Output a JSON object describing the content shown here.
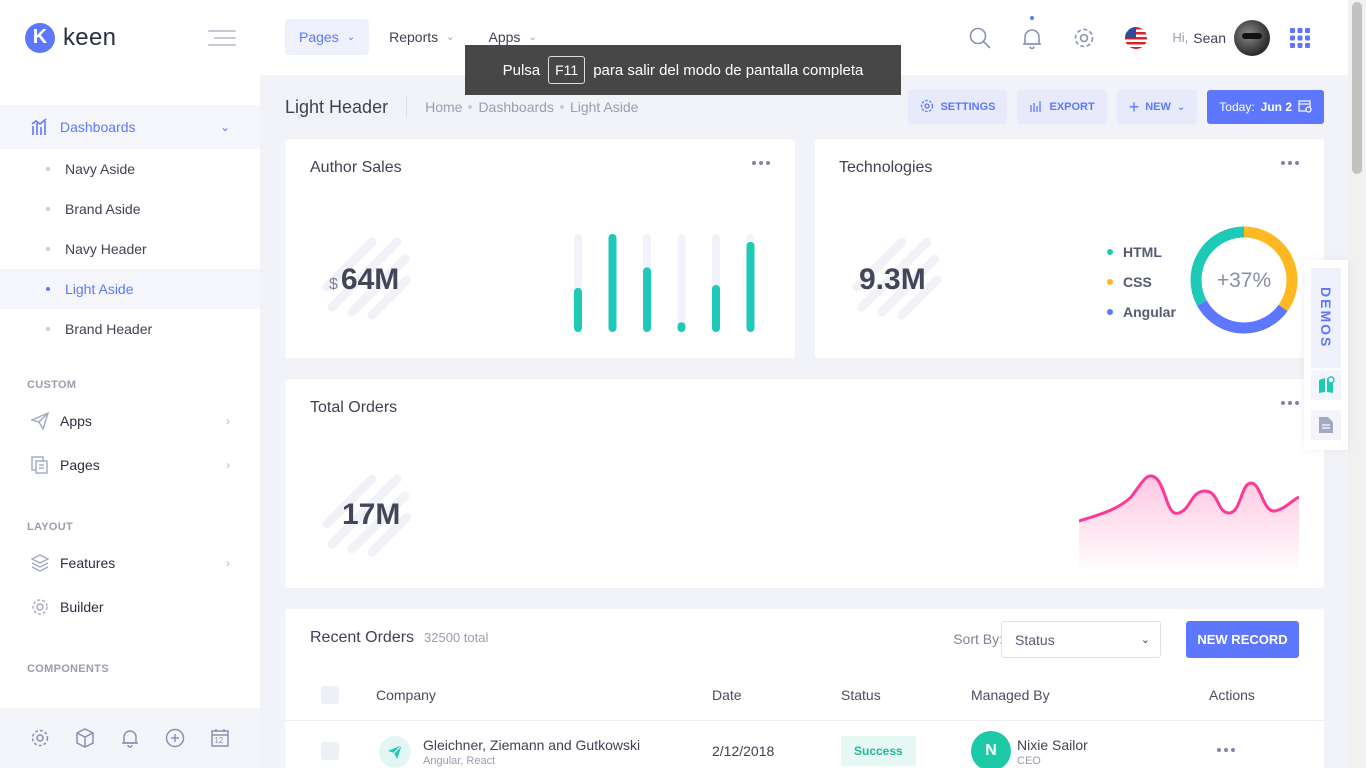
{
  "brand": {
    "name": "keen",
    "logo_letter": "K"
  },
  "sidebar": {
    "dashboards": "Dashboards",
    "dashboard_items": [
      "Navy Aside",
      "Brand Aside",
      "Navy Header",
      "Light Aside",
      "Brand Header"
    ],
    "sections": {
      "custom": "CUSTOM",
      "layout": "LAYOUT",
      "components": "COMPONENTS"
    },
    "custom_items": [
      "Apps",
      "Pages"
    ],
    "layout_items": [
      "Features",
      "Builder"
    ],
    "footer_icons": [
      "gear-icon",
      "box-icon",
      "bell-icon",
      "plus-circle-icon",
      "calendar-icon"
    ],
    "calendar_day": "12"
  },
  "header": {
    "menu": [
      "Pages",
      "Reports",
      "Apps"
    ],
    "greeting": "Hi,",
    "user": "Sean"
  },
  "toast": {
    "before": "Pulsa",
    "key": "F11",
    "after": "para salir del modo de pantalla completa"
  },
  "subheader": {
    "title": "Light Header",
    "breadcrumbs": [
      "Home",
      "Dashboards",
      "Light Aside"
    ],
    "settings": "SETTINGS",
    "export": "EXPORT",
    "new": "NEW",
    "today_label": "Today:",
    "today_value": "Jun 2"
  },
  "cards": {
    "author_sales": {
      "title": "Author Sales",
      "currency": "$",
      "value": "64M",
      "bars": [
        0.45,
        1.0,
        0.66,
        0.1,
        0.48,
        0.92
      ]
    },
    "technologies": {
      "title": "Technologies",
      "value": "9.3M",
      "legend": [
        {
          "label": "HTML",
          "color": "#1dc9b7"
        },
        {
          "label": "CSS",
          "color": "#ffb822"
        },
        {
          "label": "Angular",
          "color": "#5d78ff"
        }
      ],
      "donut_label": "+37%"
    },
    "total_orders": {
      "title": "Total Orders",
      "value": "17M"
    }
  },
  "orders": {
    "title": "Recent Orders",
    "total": "32500 total",
    "sort_label": "Sort By:",
    "status_select": "Status",
    "new_record": "NEW RECORD",
    "columns": [
      "Company",
      "Date",
      "Status",
      "Managed By",
      "Actions"
    ],
    "rows": [
      {
        "company": "Gleichner, Ziemann and Gutkowski",
        "tags": "Angular, React",
        "date": "2/12/2018",
        "status": "Success",
        "manager_initial": "N",
        "manager": "Nixie Sailor",
        "manager_role": "CEO"
      }
    ]
  },
  "demos": {
    "label": "DEMOS"
  },
  "colors": {
    "accent": "#5d78ff",
    "teal": "#1dc9b7",
    "amber": "#ffb822",
    "pink": "#fd3995"
  }
}
